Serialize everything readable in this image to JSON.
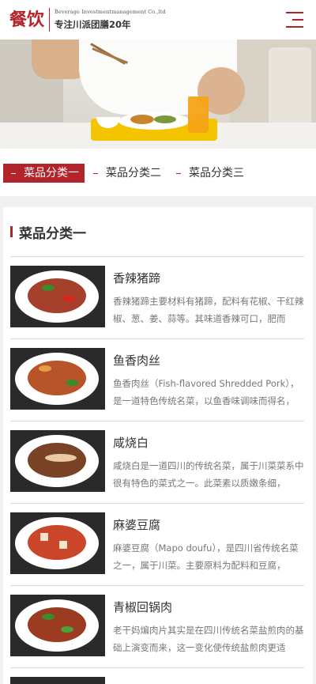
{
  "header": {
    "logo_cn": "餐饮",
    "logo_en": "Beverage Investmentmanagement Co.,ltd",
    "slogan": "专注川派团膳20年",
    "brand_color": "#b3232a",
    "menu_icon": "hamburger-menu-icon"
  },
  "tabs": [
    {
      "label": "菜品分类一",
      "active": true
    },
    {
      "label": "菜品分类二",
      "active": false
    },
    {
      "label": "菜品分类三",
      "active": false
    }
  ],
  "section": {
    "title": "菜品分类一"
  },
  "dishes": [
    {
      "title": "香辣猪蹄",
      "desc": "香辣猪蹄主要材料有猪蹄，配料有花椒、干红辣椒、葱、姜、蒜等。其味道香辣可口，肥而",
      "dish_color": "#a5412a"
    },
    {
      "title": "鱼香肉丝",
      "desc": "鱼香肉丝（Fish-flavored Shredded Pork），是一道特色传统名菜，以鱼香味调味而得名，",
      "dish_color": "#b8542a"
    },
    {
      "title": "咸烧白",
      "desc": "咸烧白是一道四川的传统名菜，属于川菜菜系中很有特色的菜式之一。此菜素以质嫩条细，",
      "dish_color": "#7a4328"
    },
    {
      "title": "麻婆豆腐",
      "desc": "麻婆豆腐（Mapo doufu），是四川省传统名菜之一，属于川菜。主要原料为配料和豆腐，",
      "dish_color": "#c9462a"
    },
    {
      "title": "青椒回锅肉",
      "desc": "老干妈煸肉片其实是在四川传统名菜盐煎肉的基础上演变而来，这一变化使传统盐煎肉更适",
      "dish_color": "#9b3b22"
    }
  ]
}
